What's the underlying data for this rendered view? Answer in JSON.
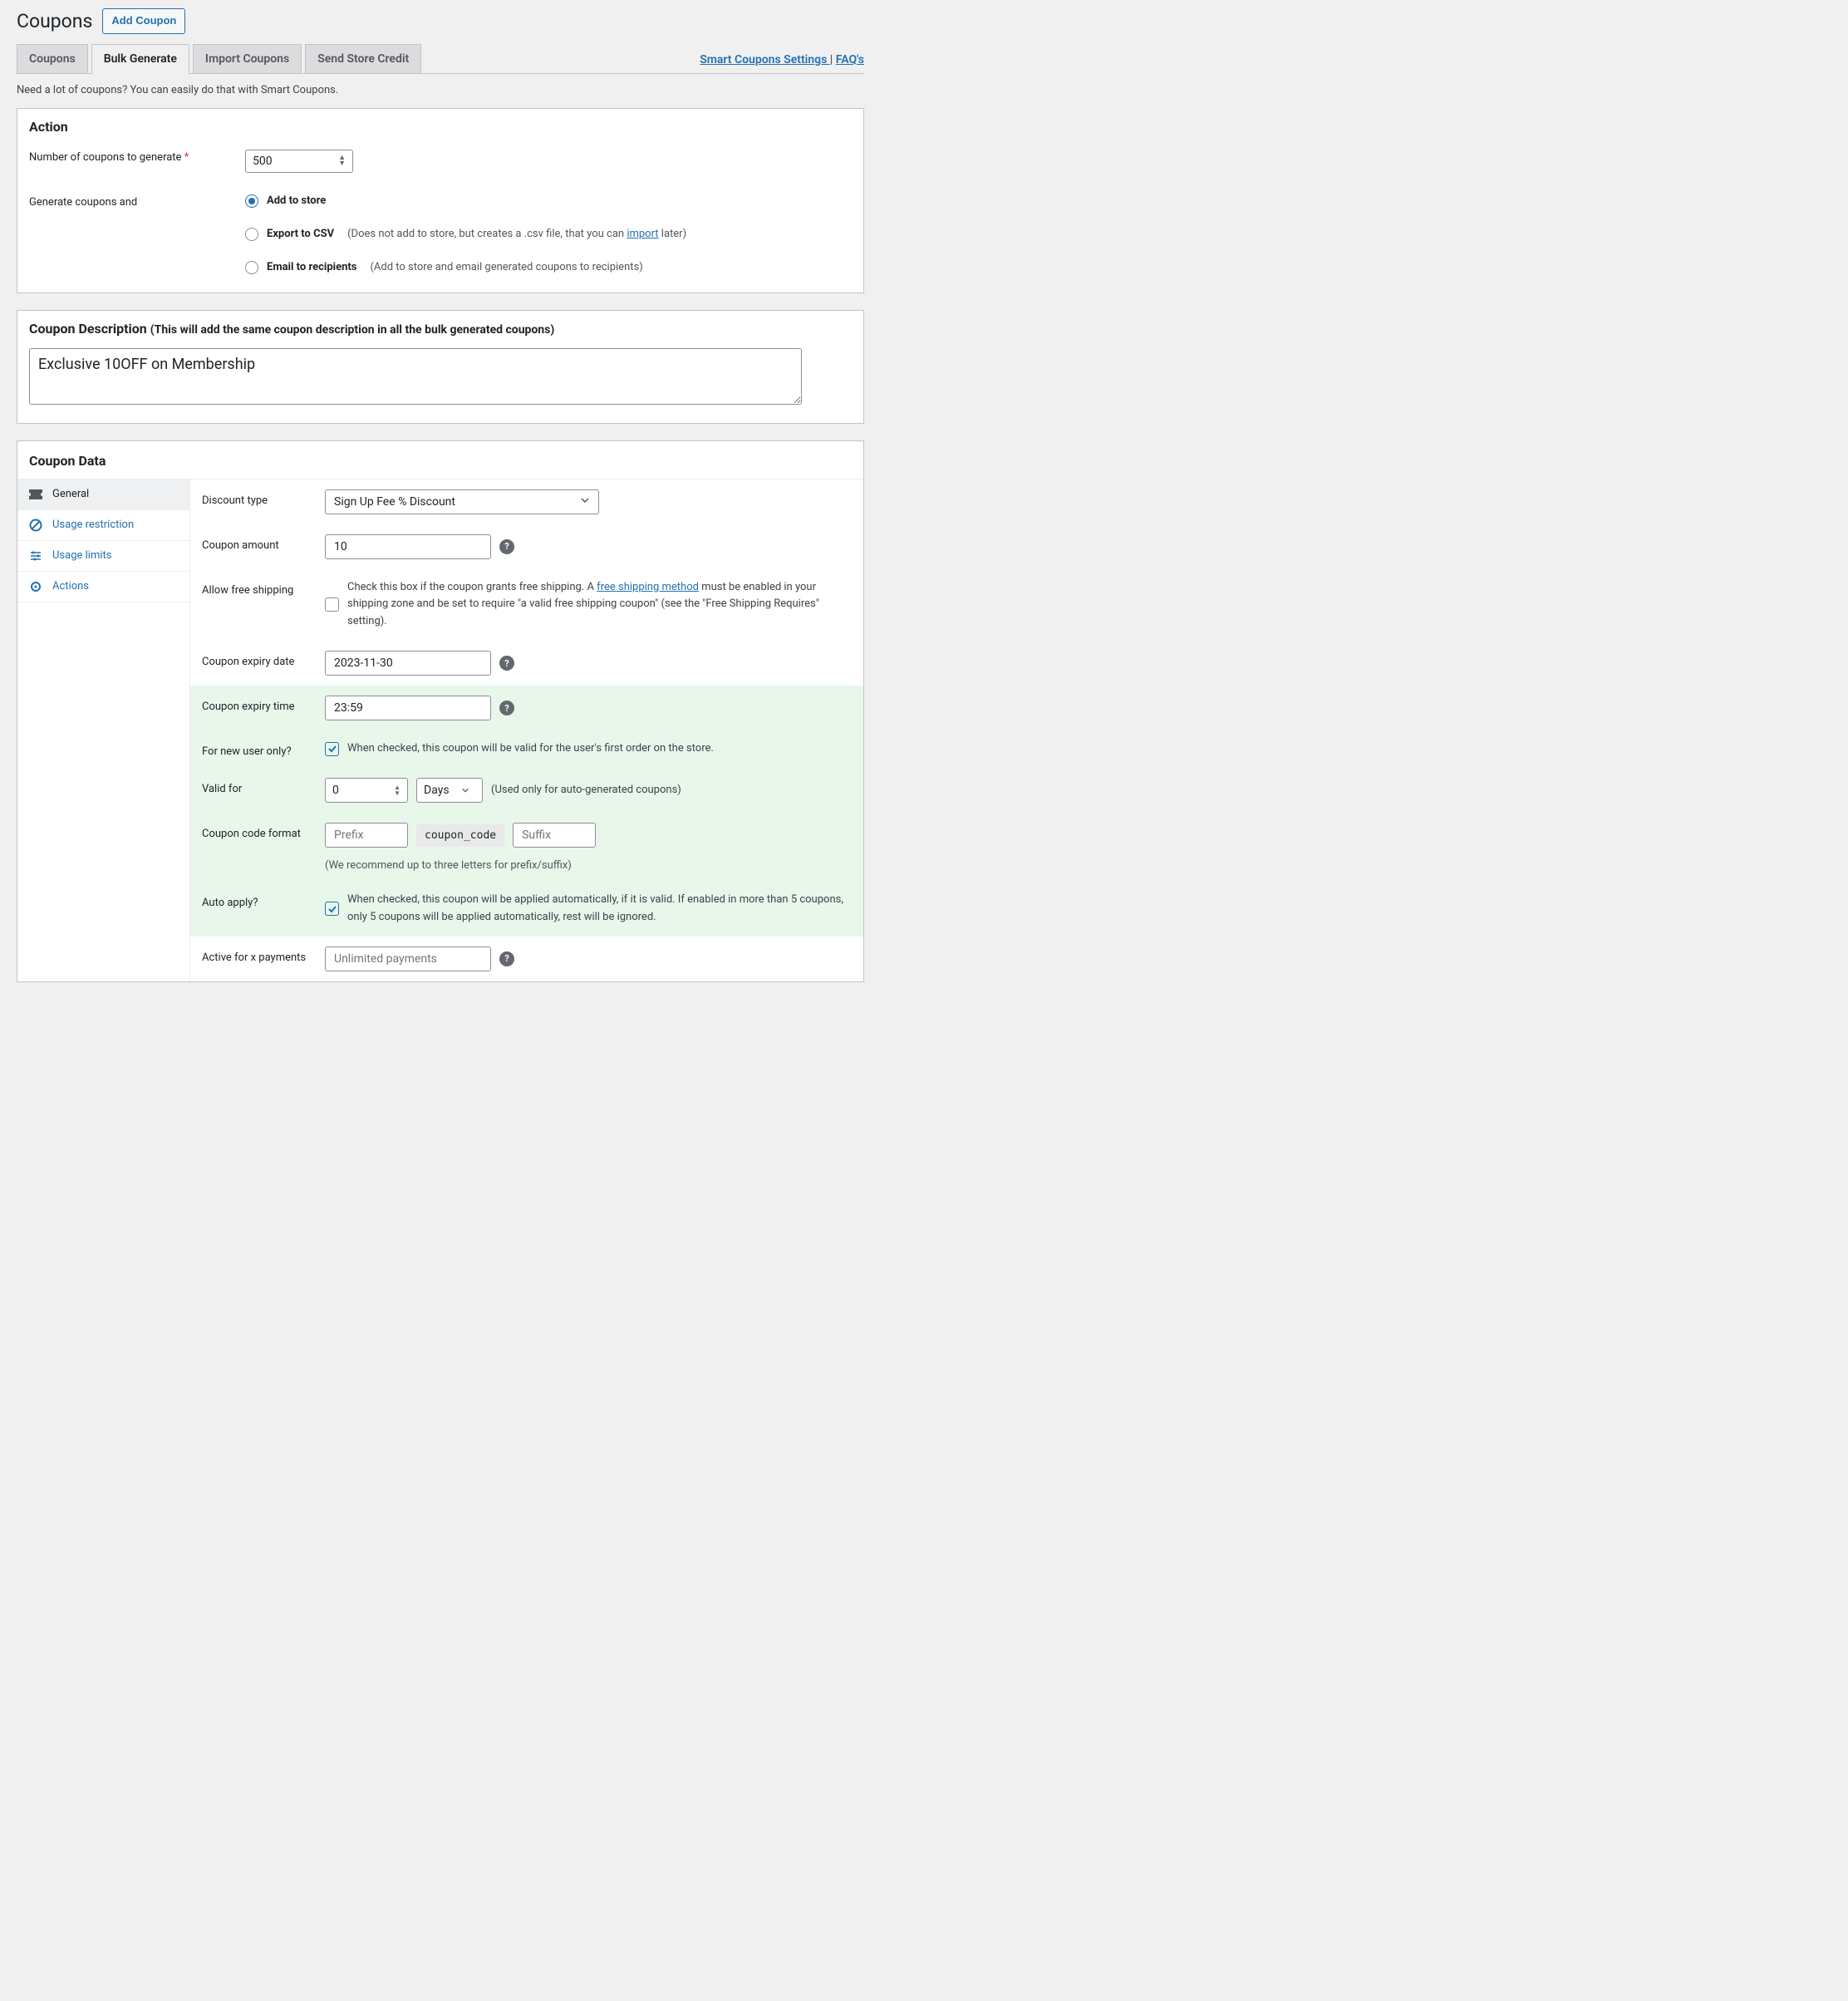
{
  "header": {
    "title": "Coupons",
    "add_button": "Add Coupon"
  },
  "tabs": {
    "coupons": "Coupons",
    "bulk_generate": "Bulk Generate",
    "import": "Import Coupons",
    "send_credit": "Send Store Credit"
  },
  "right_links": {
    "settings": "Smart Coupons Settings ",
    "sep": "| ",
    "faqs": "FAQ's"
  },
  "subtitle": "Need a lot of coupons? You can easily do that with Smart Coupons.",
  "action": {
    "heading": "Action",
    "num_label": "Number of coupons to generate ",
    "num_value": "500",
    "gen_label": "Generate coupons and",
    "opt_add": "Add to store",
    "opt_export": "Export to CSV",
    "opt_export_desc_before": "(Does not add to store, but creates a .csv file, that you can ",
    "opt_export_link": "import",
    "opt_export_desc_after": " later)",
    "opt_email": "Email to recipients",
    "opt_email_desc": "(Add to store and email generated coupons to recipients)"
  },
  "description": {
    "heading": "Coupon Description ",
    "sub": "(This will add the same coupon description in all the bulk generated coupons)",
    "value": "Exclusive 10OFF on Membership"
  },
  "coupon_data": {
    "heading": "Coupon Data",
    "side": {
      "general": "General",
      "usage_restriction": "Usage restriction",
      "usage_limits": "Usage limits",
      "actions": "Actions"
    },
    "discount_type": {
      "label": "Discount type",
      "value": "Sign Up Fee % Discount"
    },
    "amount": {
      "label": "Coupon amount",
      "value": "10"
    },
    "free_shipping": {
      "label": "Allow free shipping",
      "text_before": "Check this box if the coupon grants free shipping. A ",
      "link": "free shipping method",
      "text_after": " must be enabled in your shipping zone and be set to require \"a valid free shipping coupon\" (see the \"Free Shipping Requires\" setting)."
    },
    "expiry_date": {
      "label": "Coupon expiry date",
      "value": "2023-11-30"
    },
    "expiry_time": {
      "label": "Coupon expiry time",
      "value": "23:59"
    },
    "new_user": {
      "label": "For new user only?",
      "text": "When checked, this coupon will be valid for the user's first order on the store."
    },
    "valid_for": {
      "label": "Valid for",
      "value": "0",
      "unit": "Days",
      "note": "(Used only for auto-generated coupons)"
    },
    "code_format": {
      "label": "Coupon code format",
      "prefix_ph": "Prefix",
      "code_tag": "coupon_code",
      "suffix_ph": "Suffix",
      "note": "(We recommend up to three letters for prefix/suffix)"
    },
    "auto_apply": {
      "label": "Auto apply?",
      "text": "When checked, this coupon will be applied automatically, if it is valid. If enabled in more than 5 coupons, only 5 coupons will be applied automatically, rest will be ignored."
    },
    "active_payments": {
      "label": "Active for x payments",
      "placeholder": "Unlimited payments"
    }
  }
}
